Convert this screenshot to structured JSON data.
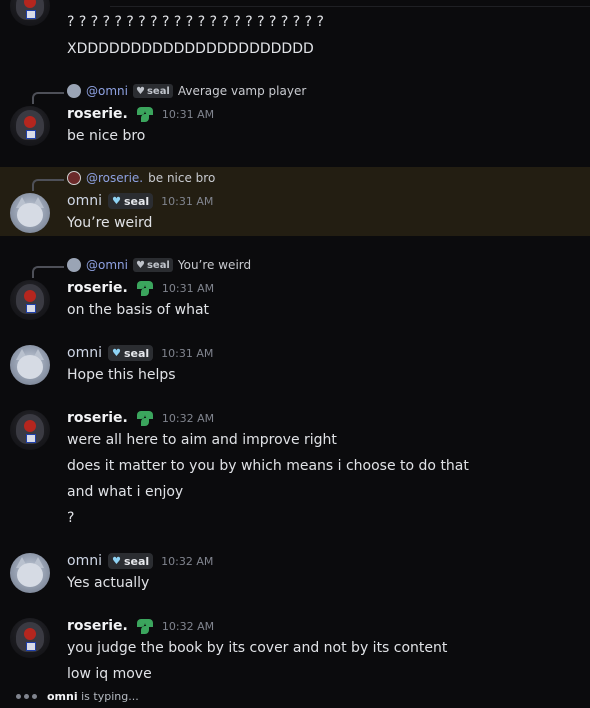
{
  "messages": [
    {
      "lines": [
        "? ? ? ? ? ? ? ? ? ? ? ? ? ? ? ? ? ? ? ? ? ?",
        "XDDDDDDDDDDDDDDDDDDDDDD"
      ]
    },
    {
      "reply": {
        "mention": "@omni",
        "tag": "seal",
        "text": "Average vamp player"
      },
      "user": "roserie.",
      "time": "10:31 AM",
      "lines": [
        "be nice bro"
      ]
    },
    {
      "reply": {
        "mention": "@roserie.",
        "text": "be nice bro"
      },
      "user": "omni",
      "tag": "seal",
      "time": "10:31 AM",
      "lines": [
        "You’re weird"
      ]
    },
    {
      "reply": {
        "mention": "@omni",
        "tag": "seal",
        "text": "You’re weird"
      },
      "user": "roserie.",
      "time": "10:31 AM",
      "lines": [
        "on the basis of what"
      ]
    },
    {
      "user": "omni",
      "tag": "seal",
      "time": "10:31 AM",
      "lines": [
        "Hope this helps"
      ]
    },
    {
      "user": "roserie.",
      "time": "10:32 AM",
      "lines": [
        "were all here to aim and improve right",
        "does it matter to you by which means i choose to do that",
        "and what i enjoy",
        "?"
      ]
    },
    {
      "user": "omni",
      "tag": "seal",
      "time": "10:32 AM",
      "lines": [
        "Yes actually"
      ]
    },
    {
      "user": "roserie.",
      "time": "10:32 AM",
      "lines": [
        "you judge the book by its cover and not by its content",
        "low iq move"
      ]
    }
  ],
  "typing": {
    "user": "omni",
    "suffix": "is typing..."
  },
  "colors": {
    "background": "#0b0b0d",
    "highlight": "#231e12",
    "mention": "#8ea1e1",
    "leaf": "#3ba55d"
  }
}
